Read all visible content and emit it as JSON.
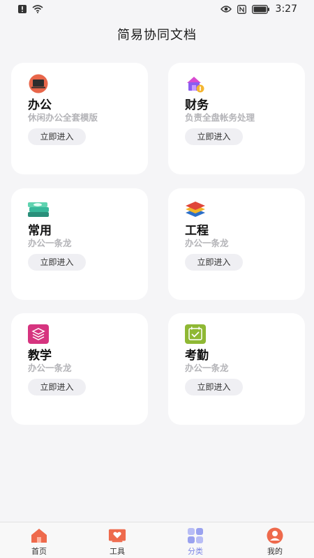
{
  "status_bar": {
    "time": "3:27",
    "left_icons": [
      "alert-icon",
      "wifi-icon"
    ],
    "right_icons": [
      "eye-icon",
      "nfc-icon",
      "battery-icon"
    ]
  },
  "header": {
    "title": "简易协同文档"
  },
  "categories": [
    {
      "name": "办公",
      "desc": "休闲办公全套模版",
      "button": "立即进入",
      "icon": "laptop-icon",
      "color": "#e8664a"
    },
    {
      "name": "财务",
      "desc": "负责全盘帐务处理",
      "button": "立即进入",
      "icon": "finance-house-icon",
      "color": "#8a5cf0"
    },
    {
      "name": "常用",
      "desc": "办公一条龙",
      "button": "立即进入",
      "icon": "stack-icon",
      "color": "#2fb58a"
    },
    {
      "name": "工程",
      "desc": "办公一条龙",
      "button": "立即进入",
      "icon": "layers-icon",
      "color": "#e0463a"
    },
    {
      "name": "教学",
      "desc": "办公一条龙",
      "button": "立即进入",
      "icon": "book-layers-icon",
      "color": "#d6347f"
    },
    {
      "name": "考勤",
      "desc": "办公一条龙",
      "button": "立即进入",
      "icon": "calendar-check-icon",
      "color": "#8fb834"
    }
  ],
  "bottom_nav": [
    {
      "label": "首页",
      "icon": "home-icon",
      "active": false
    },
    {
      "label": "工具",
      "icon": "tools-icon",
      "active": false
    },
    {
      "label": "分类",
      "icon": "category-grid-icon",
      "active": true
    },
    {
      "label": "我的",
      "icon": "profile-icon",
      "active": false
    }
  ],
  "colors": {
    "accent": "#7b85e6",
    "background": "#f5f5f7",
    "card": "#ffffff",
    "button_bg": "#efeff3"
  }
}
